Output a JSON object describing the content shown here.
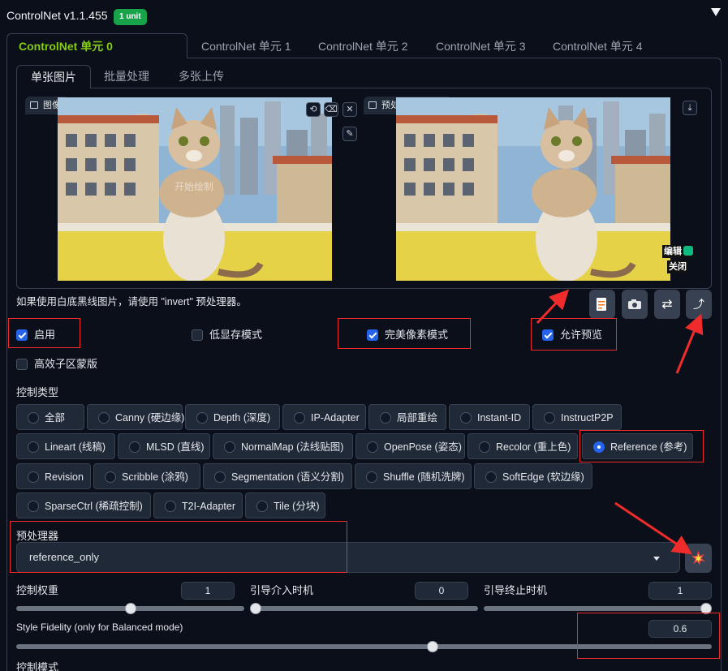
{
  "header": {
    "title": "ControlNet v1.1.455",
    "badge": "1 unit"
  },
  "unit_tabs": [
    {
      "label": "ControlNet 单元 0 [Reference]",
      "active": true
    },
    {
      "label": "ControlNet 单元 1"
    },
    {
      "label": "ControlNet 单元 2"
    },
    {
      "label": "ControlNet 单元 3"
    },
    {
      "label": "ControlNet 单元 4"
    }
  ],
  "mode_tabs": [
    {
      "label": "单张图片",
      "active": true
    },
    {
      "label": "批量处理"
    },
    {
      "label": "多张上传"
    }
  ],
  "image_panel": {
    "input_label": "图像",
    "input_watermark": "开始绘制",
    "preview_label": "预处理结果预览",
    "edit_label": "编辑",
    "close_label": "关闭"
  },
  "hint": "如果使用白底黑线图片，请使用 \"invert\" 预处理器。",
  "options": {
    "enable": {
      "label": "启用",
      "checked": true
    },
    "low_vram": {
      "label": "低显存模式",
      "checked": false
    },
    "pixel_perfect": {
      "label": "完美像素模式",
      "checked": true
    },
    "allow_preview": {
      "label": "允许预览",
      "checked": true
    },
    "efficient_mask": {
      "label": "高效子区蒙版",
      "checked": false
    }
  },
  "control_type": {
    "label": "控制类型",
    "options": [
      "全部",
      "Canny (硬边缘)",
      "Depth (深度)",
      "IP-Adapter",
      "局部重绘",
      "Instant-ID",
      "InstructP2P",
      "Lineart (线稿)",
      "MLSD (直线)",
      "NormalMap (法线贴图)",
      "OpenPose (姿态)",
      "Recolor (重上色)",
      "Reference (参考)",
      "Revision",
      "Scribble (涂鸦)",
      "Segmentation (语义分割)",
      "Shuffle (随机洗牌)",
      "SoftEdge (软边缘)",
      "SparseCtrl (稀疏控制)",
      "T2I-Adapter",
      "Tile (分块)"
    ],
    "selected": "Reference (参考)"
  },
  "preprocessor": {
    "label": "预处理器",
    "value": "reference_only"
  },
  "sliders": {
    "weight": {
      "label": "控制权重",
      "value": "1",
      "fraction": 0.5
    },
    "start": {
      "label": "引导介入时机",
      "value": "0",
      "fraction": 0.0
    },
    "end": {
      "label": "引导终止时机",
      "value": "1",
      "fraction": 1.0
    },
    "fidelity": {
      "label": "Style Fidelity (only for Balanced mode)",
      "value": "0.6",
      "fraction": 0.6
    }
  },
  "control_mode": {
    "label": "控制模式"
  },
  "colors": {
    "accent": "#84cc16",
    "primary": "#2563eb",
    "badge": "#16a34a",
    "annotation": "#ef2b2b"
  }
}
